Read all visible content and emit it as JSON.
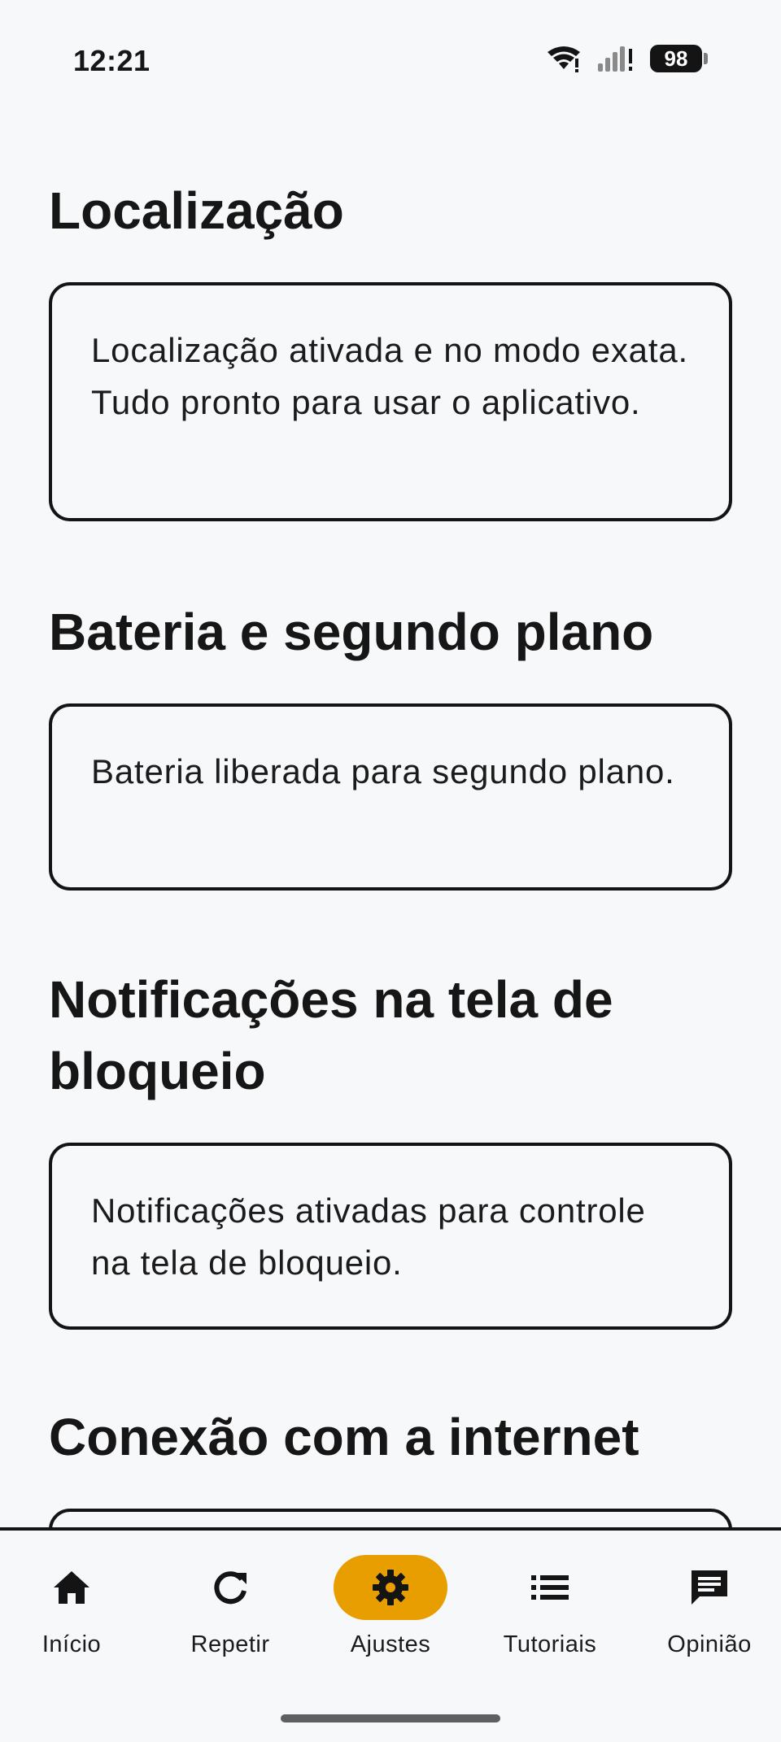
{
  "status_bar": {
    "time": "12:21",
    "battery_level": "98",
    "icons": [
      "wifi-icon",
      "cellular-signal-icon",
      "battery-icon"
    ]
  },
  "sections": [
    {
      "title": "Localização",
      "message": "Localização ativada e no modo exata. Tudo pronto para usar o aplicativo."
    },
    {
      "title": "Bateria e segundo plano",
      "message": "Bateria liberada para segundo plano."
    },
    {
      "title": "Notificações na tela de bloqueio",
      "message": "Notificações ativadas para controle na tela de bloqueio."
    },
    {
      "title": "Conexão com a internet",
      "message": ""
    }
  ],
  "bottom_nav": {
    "items": [
      {
        "label": "Início",
        "icon": "home-icon"
      },
      {
        "label": "Repetir",
        "icon": "refresh-icon"
      },
      {
        "label": "Ajustes",
        "icon": "gear-icon",
        "active": true
      },
      {
        "label": "Tutoriais",
        "icon": "list-icon"
      },
      {
        "label": "Opinião",
        "icon": "feedback-icon"
      }
    ],
    "active_color": "#e89d00"
  }
}
